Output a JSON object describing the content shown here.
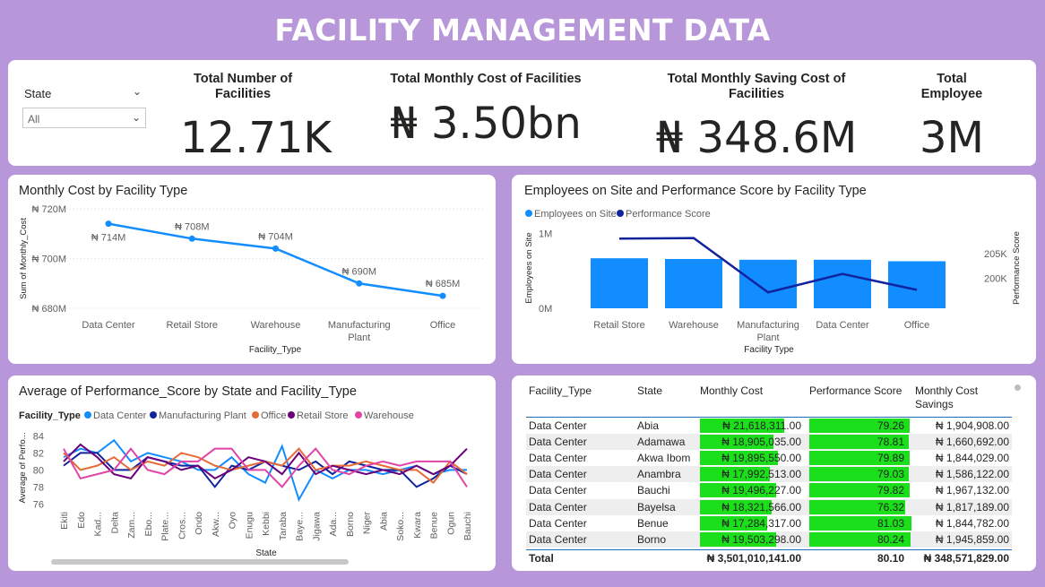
{
  "page_title": "FACILITY MANAGEMENT DATA",
  "slicer": {
    "label": "State",
    "value": "All"
  },
  "kpis": [
    {
      "label": "Total Number of Facilities",
      "value": "12.71K"
    },
    {
      "label": "Total Monthly Cost of Facilities",
      "value": "₦ 3.50bn"
    },
    {
      "label": "Total Monthly Saving Cost of Facilities",
      "value": "₦ 348.6M"
    },
    {
      "label": "Total Employee",
      "value": "3M"
    }
  ],
  "colors": {
    "background": "#b896da",
    "series_blue": "#118dff",
    "series_navy": "#12239e",
    "series_orange": "#e66c37",
    "series_purple": "#6b007b",
    "series_pink": "#e044a7",
    "table_bar": "#1adf1a"
  },
  "chart_data": [
    {
      "type": "line",
      "title": "Monthly Cost by Facility Type",
      "xlabel": "Facility_Type",
      "ylabel": "Sum of Monthly_Cost",
      "categories": [
        "Data Center",
        "Retail Store",
        "Warehouse",
        "Manufacturing Plant",
        "Office"
      ],
      "values": [
        714,
        708,
        704,
        690,
        685
      ],
      "data_labels": [
        "₦ 714M",
        "₦ 708M",
        "₦ 704M",
        "₦ 690M",
        "₦ 685M"
      ],
      "y_ticks": [
        "₦ 720M",
        "₦ 700M",
        "₦ 680M"
      ],
      "y_tick_values": [
        720,
        700,
        680
      ],
      "ylim": [
        680,
        720
      ],
      "unit": "M"
    },
    {
      "type": "bar",
      "title": "Employees on Site and Performance Score by Facility Type",
      "xlabel": "Facility Type",
      "ylabel": "Employees on Site",
      "y2label": "Performance Score",
      "legend": [
        "Employees on Site",
        "Performance Score"
      ],
      "categories": [
        "Retail Store",
        "Warehouse",
        "Manufacturing Plant",
        "Data Center",
        "Office"
      ],
      "series": [
        {
          "name": "Employees on Site",
          "kind": "bar",
          "axis": "left",
          "values": [
            0.67,
            0.66,
            0.65,
            0.65,
            0.63
          ]
        },
        {
          "name": "Performance Score",
          "kind": "line",
          "axis": "right",
          "values": [
            208,
            208.1,
            197.2,
            200.9,
            197.7
          ]
        }
      ],
      "y_ticks": [
        "1M",
        "0M"
      ],
      "y_tick_values": [
        1,
        0
      ],
      "ylim": [
        0,
        1.2
      ],
      "y2_ticks": [
        "205K",
        "200K"
      ],
      "y2_tick_values": [
        205,
        200
      ],
      "y2lim": [
        194,
        212
      ]
    },
    {
      "type": "line",
      "title": "Average of Performance_Score by State and Facility_Type",
      "xlabel": "State",
      "ylabel": "Average of Perfo...",
      "legend_title": "Facility_Type",
      "categories": [
        "Ekiti",
        "Edo",
        "Kad...",
        "Delta",
        "Zam...",
        "Ebo...",
        "Plate...",
        "Cros...",
        "Ondo",
        "Akw...",
        "Oyo",
        "Enugu",
        "Kebbi",
        "Taraba",
        "Baye...",
        "Jigawa",
        "Ada...",
        "Borno",
        "Niger",
        "Abia",
        "Soko...",
        "Kwara",
        "Benue",
        "Ogun",
        "Bauchi"
      ],
      "y_ticks": [
        "84",
        "82",
        "80",
        "78",
        "76"
      ],
      "ylim": [
        75.5,
        85
      ],
      "series": [
        {
          "name": "Data Center",
          "values": [
            81.5,
            82.5,
            82.0,
            83.5,
            81.0,
            82.0,
            81.5,
            81.0,
            80.0,
            80.0,
            81.5,
            79.5,
            78.5,
            82.8,
            76.5,
            80.0,
            79.0,
            80.0,
            80.0,
            79.5,
            80.0,
            80.5,
            79.5,
            80.0,
            80.0
          ]
        },
        {
          "name": "Manufacturing Plant",
          "values": [
            80.5,
            82.0,
            82.0,
            80.0,
            80.0,
            81.5,
            81.0,
            80.5,
            80.5,
            78.0,
            80.5,
            80.0,
            81.0,
            80.5,
            80.0,
            81.0,
            79.5,
            81.0,
            80.5,
            80.0,
            80.0,
            78.0,
            79.0,
            80.5,
            79.5
          ]
        },
        {
          "name": "Office",
          "values": [
            82.0,
            80.0,
            80.5,
            81.5,
            80.0,
            81.0,
            80.5,
            82.0,
            81.5,
            80.5,
            80.0,
            80.5,
            81.0,
            80.5,
            82.5,
            80.0,
            80.5,
            80.5,
            81.0,
            80.5,
            80.0,
            80.0,
            78.5,
            81.0,
            79.5
          ]
        },
        {
          "name": "Retail Store",
          "values": [
            81.0,
            83.0,
            81.5,
            79.5,
            79.0,
            81.5,
            81.0,
            80.0,
            80.5,
            79.0,
            80.0,
            81.5,
            81.0,
            79.5,
            82.0,
            79.5,
            80.5,
            80.0,
            79.5,
            80.0,
            79.5,
            80.5,
            79.5,
            80.5,
            82.5
          ]
        },
        {
          "name": "Warehouse",
          "values": [
            82.5,
            79.0,
            79.5,
            80.0,
            82.5,
            80.0,
            79.5,
            81.0,
            81.0,
            82.5,
            82.5,
            80.0,
            80.0,
            78.0,
            80.5,
            82.5,
            80.0,
            79.5,
            80.5,
            81.0,
            80.5,
            81.0,
            81.0,
            81.0,
            78.0
          ]
        }
      ]
    },
    {
      "type": "table",
      "columns": [
        "Facility_Type",
        "State",
        "Monthly Cost",
        "Performance Score",
        "Monthly Cost Savings"
      ],
      "rows": [
        {
          "facility_type": "Data Center",
          "state": "Abia",
          "monthly_cost": "₦ 21,618,311.00",
          "monthly_cost_value": 21618311,
          "performance": "79.26",
          "performance_value": 79.26,
          "savings": "₦ 1,904,908.00"
        },
        {
          "facility_type": "Data Center",
          "state": "Adamawa",
          "monthly_cost": "₦ 18,905,035.00",
          "monthly_cost_value": 18905035,
          "performance": "78.81",
          "performance_value": 78.81,
          "savings": "₦ 1,660,692.00"
        },
        {
          "facility_type": "Data Center",
          "state": "Akwa Ibom",
          "monthly_cost": "₦ 19,895,550.00",
          "monthly_cost_value": 19895550,
          "performance": "79.89",
          "performance_value": 79.89,
          "savings": "₦ 1,844,029.00"
        },
        {
          "facility_type": "Data Center",
          "state": "Anambra",
          "monthly_cost": "₦ 17,992,513.00",
          "monthly_cost_value": 17992513,
          "performance": "79.03",
          "performance_value": 79.03,
          "savings": "₦ 1,586,122.00"
        },
        {
          "facility_type": "Data Center",
          "state": "Bauchi",
          "monthly_cost": "₦ 19,496,227.00",
          "monthly_cost_value": 19496227,
          "performance": "79.82",
          "performance_value": 79.82,
          "savings": "₦ 1,967,132.00"
        },
        {
          "facility_type": "Data Center",
          "state": "Bayelsa",
          "monthly_cost": "₦ 18,321,566.00",
          "monthly_cost_value": 18321566,
          "performance": "76.32",
          "performance_value": 76.32,
          "savings": "₦ 1,817,189.00"
        },
        {
          "facility_type": "Data Center",
          "state": "Benue",
          "monthly_cost": "₦ 17,284,317.00",
          "monthly_cost_value": 17284317,
          "performance": "81.03",
          "performance_value": 81.03,
          "savings": "₦ 1,844,782.00"
        },
        {
          "facility_type": "Data Center",
          "state": "Borno",
          "monthly_cost": "₦ 19,503,298.00",
          "monthly_cost_value": 19503298,
          "performance": "80.24",
          "performance_value": 80.24,
          "savings": "₦ 1,945,859.00"
        }
      ],
      "total": {
        "label": "Total",
        "monthly_cost": "₦ 3,501,010,141.00",
        "performance": "80.10",
        "savings": "₦ 348,571,829.00"
      }
    }
  ]
}
